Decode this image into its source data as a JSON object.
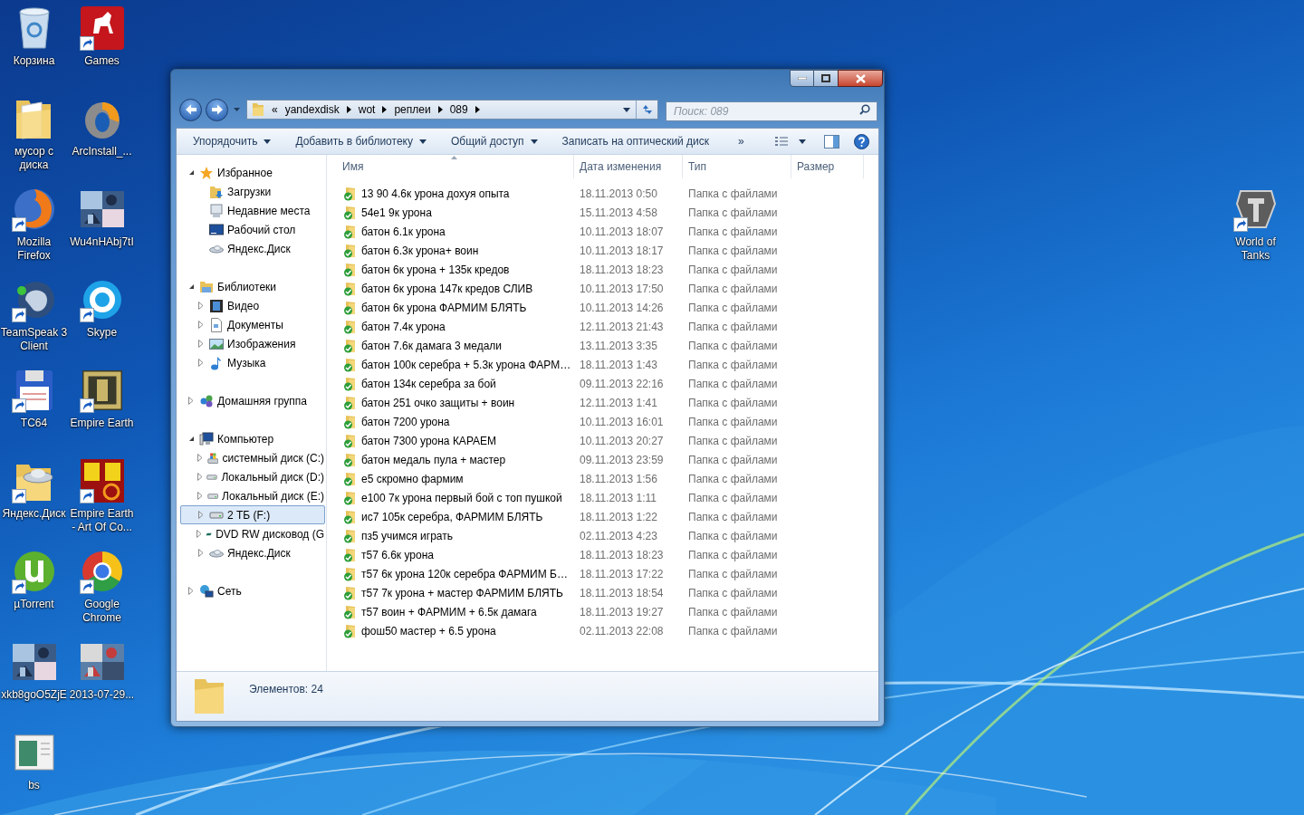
{
  "desktop_icons": [
    {
      "label": "Корзина",
      "kind": "bin",
      "shortcut": false
    },
    {
      "label": "Games",
      "kind": "zynga",
      "shortcut": true
    },
    {
      "label": "мусор с диска",
      "kind": "folder",
      "shortcut": false
    },
    {
      "label": "ArcInstall_...",
      "kind": "arc",
      "shortcut": false
    },
    {
      "label": "Mozilla Firefox",
      "kind": "firefox",
      "shortcut": true
    },
    {
      "label": "Wu4nHAbj7tI",
      "kind": "picture",
      "shortcut": false
    },
    {
      "label": "TeamSpeak 3 Client",
      "kind": "teamspeak",
      "shortcut": true
    },
    {
      "label": "Skype",
      "kind": "skype",
      "shortcut": true
    },
    {
      "label": "TC64",
      "kind": "floppy",
      "shortcut": true
    },
    {
      "label": "Empire Earth",
      "kind": "empire",
      "shortcut": true
    },
    {
      "label": "Яндекс.Диск",
      "kind": "yandex",
      "shortcut": true
    },
    {
      "label": "Empire Earth - Art Of Co...",
      "kind": "ee",
      "shortcut": true
    },
    {
      "label": "µTorrent",
      "kind": "utorrent",
      "shortcut": true
    },
    {
      "label": "Google Chrome",
      "kind": "chrome",
      "shortcut": true
    },
    {
      "label": "xkb8goO5ZjE",
      "kind": "picture",
      "shortcut": false
    },
    {
      "label": "2013-07-29...",
      "kind": "picture",
      "shortcut": false
    },
    {
      "label": "bs",
      "kind": "document",
      "shortcut": false
    }
  ],
  "right_icons": [
    {
      "label": "World of Tanks",
      "kind": "shield",
      "shortcut": true
    }
  ],
  "explorer": {
    "address": {
      "overflow": "«",
      "crumbs": [
        "yandexdisk",
        "wot",
        "реплеи",
        "089"
      ]
    },
    "search": {
      "placeholder": "Поиск: 089"
    },
    "toolbar": [
      {
        "label": "Упорядочить",
        "dropdown": true
      },
      {
        "label": "Добавить в библиотеку",
        "dropdown": true
      },
      {
        "label": "Общий доступ",
        "dropdown": true
      },
      {
        "label": "Записать на оптический диск",
        "dropdown": false
      }
    ],
    "toolbar_more": "»",
    "sidebar": {
      "groups": [
        {
          "label": "Избранное",
          "kind": "star",
          "expanded": true,
          "children": [
            {
              "label": "Загрузки",
              "kind": "downloads",
              "selected": false
            },
            {
              "label": "Недавние места",
              "kind": "recent",
              "selected": false
            },
            {
              "label": "Рабочий стол",
              "kind": "desktop",
              "selected": false
            },
            {
              "label": "Яндекс.Диск",
              "kind": "cloud",
              "selected": false
            }
          ]
        },
        {
          "label": "Библиотеки",
          "kind": "library",
          "expanded": true,
          "children": [
            {
              "label": "Видео",
              "kind": "video",
              "selected": false,
              "expanded": false
            },
            {
              "label": "Документы",
              "kind": "docs",
              "selected": false,
              "expanded": false
            },
            {
              "label": "Изображения",
              "kind": "images",
              "selected": false,
              "expanded": false
            },
            {
              "label": "Музыка",
              "kind": "music",
              "selected": false,
              "expanded": false
            }
          ]
        },
        {
          "label": "Домашняя группа",
          "kind": "homegroup",
          "expanded": false
        },
        {
          "label": "Компьютер",
          "kind": "computer",
          "expanded": true,
          "children": [
            {
              "label": "системный диск (C:)",
              "kind": "sysdrive",
              "selected": false,
              "expanded": false
            },
            {
              "label": "Локальный диск (D:)",
              "kind": "drive",
              "selected": false,
              "expanded": false
            },
            {
              "label": "Локальный диск (E:)",
              "kind": "drive",
              "selected": false,
              "expanded": false
            },
            {
              "label": "2 ТБ (F:)",
              "kind": "drive",
              "selected": true,
              "expanded": false
            },
            {
              "label": "DVD RW дисковод (G",
              "kind": "dvd",
              "selected": false,
              "expanded": false
            },
            {
              "label": "Яндекс.Диск",
              "kind": "cloud",
              "selected": false,
              "expanded": false
            }
          ]
        },
        {
          "label": "Сеть",
          "kind": "network",
          "expanded": false
        }
      ]
    },
    "columns": [
      {
        "label": "Имя",
        "sorted": true
      },
      {
        "label": "Дата изменения",
        "sorted": false
      },
      {
        "label": "Тип",
        "sorted": false
      },
      {
        "label": "Размер",
        "sorted": false
      }
    ],
    "rows": [
      {
        "name": "13 90 4.6к урона дохуя опыта",
        "date": "18.11.2013 0:50",
        "type": "Папка с файлами"
      },
      {
        "name": "54e1 9к урона",
        "date": "15.11.2013 4:58",
        "type": "Папка с файлами"
      },
      {
        "name": "батон 6.1к урона",
        "date": "10.11.2013 18:07",
        "type": "Папка с файлами"
      },
      {
        "name": "батон 6.3к урона+ воин",
        "date": "10.11.2013 18:17",
        "type": "Папка с файлами"
      },
      {
        "name": "батон 6к урона + 135к кредов",
        "date": "18.11.2013 18:23",
        "type": "Папка с файлами"
      },
      {
        "name": "батон 6к урона 147к кредов СЛИВ",
        "date": "10.11.2013 17:50",
        "type": "Папка с файлами"
      },
      {
        "name": "батон 6к урона ФАРМИМ БЛЯТЬ",
        "date": "10.11.2013 14:26",
        "type": "Папка с файлами"
      },
      {
        "name": "батон 7.4к урона",
        "date": "12.11.2013 21:43",
        "type": "Папка с файлами"
      },
      {
        "name": "батон 7.6к дамага 3 медали",
        "date": "13.11.2013 3:35",
        "type": "Папка с файлами"
      },
      {
        "name": "батон 100к серебра + 5.3к урона ФАРМ…",
        "date": "18.11.2013 1:43",
        "type": "Папка с файлами"
      },
      {
        "name": "батон 134к серебра за бой",
        "date": "09.11.2013 22:16",
        "type": "Папка с файлами"
      },
      {
        "name": "батон 251 очко защиты + воин",
        "date": "12.11.2013 1:41",
        "type": "Папка с файлами"
      },
      {
        "name": "батон 7200 урона",
        "date": "10.11.2013 16:01",
        "type": "Папка с файлами"
      },
      {
        "name": "батон 7300 урона КАРАЕМ",
        "date": "10.11.2013 20:27",
        "type": "Папка с файлами"
      },
      {
        "name": "батон медаль пула + мастер",
        "date": "09.11.2013 23:59",
        "type": "Папка с файлами"
      },
      {
        "name": "е5 скромно фармим",
        "date": "18.11.2013 1:56",
        "type": "Папка с файлами"
      },
      {
        "name": "е100 7к урона первый бой с топ пушкой",
        "date": "18.11.2013 1:11",
        "type": "Папка с файлами"
      },
      {
        "name": "ис7 105к серебра, ФАРМИМ БЛЯТЬ",
        "date": "18.11.2013 1:22",
        "type": "Папка с файлами"
      },
      {
        "name": "пз5 учимся играть",
        "date": "02.11.2013 4:23",
        "type": "Папка с файлами"
      },
      {
        "name": "т57 6.6к урона",
        "date": "18.11.2013 18:23",
        "type": "Папка с файлами"
      },
      {
        "name": "т57 6к урона 120к серебра ФАРМИМ Б…",
        "date": "18.11.2013 17:22",
        "type": "Папка с файлами"
      },
      {
        "name": "т57 7к урона + мастер ФАРМИМ БЛЯТЬ",
        "date": "18.11.2013 18:54",
        "type": "Папка с файлами"
      },
      {
        "name": "т57 воин + ФАРМИМ + 6.5к дамага",
        "date": "18.11.2013 19:27",
        "type": "Папка с файлами"
      },
      {
        "name": "фош50 мастер + 6.5 урона",
        "date": "02.11.2013 22:08",
        "type": "Папка с файлами"
      }
    ],
    "status": "Элементов: 24"
  }
}
